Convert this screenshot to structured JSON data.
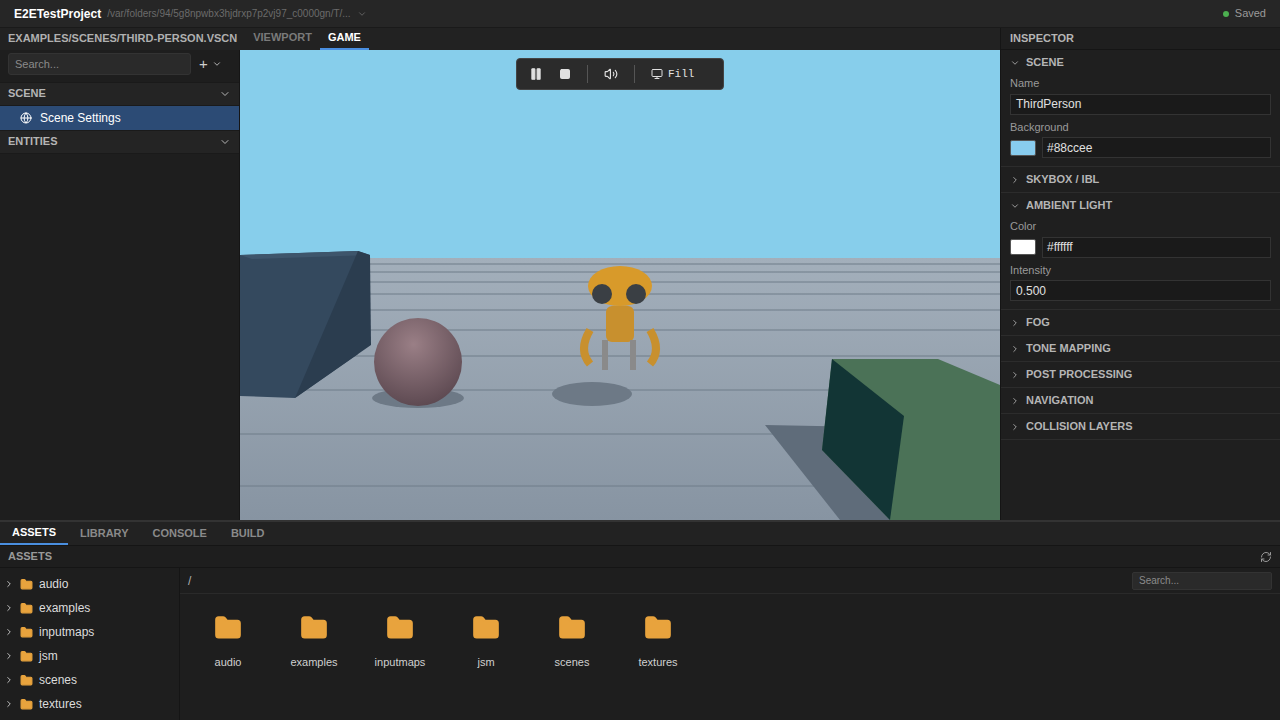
{
  "titlebar": {
    "project": "E2ETestProject",
    "path": "/var/folders/94/5g8npwbx3hjdrxp7p2vj97_c0000gn/T/...",
    "status": "Saved"
  },
  "document_path": "EXAMPLES/SCENES/THIRD-PERSON.VSCN",
  "view_tabs": [
    {
      "label": "VIEWPORT",
      "selected": false
    },
    {
      "label": "GAME",
      "selected": true
    }
  ],
  "hierarchy": {
    "search_placeholder": "Search...",
    "add_button": "+",
    "sections": [
      {
        "label": "SCENE",
        "expanded": true,
        "items": [
          {
            "label": "Scene Settings",
            "selected": true
          }
        ]
      },
      {
        "label": "ENTITIES",
        "expanded": true,
        "items": []
      }
    ]
  },
  "game_toolbar": {
    "fill_label": "Fill"
  },
  "inspector": {
    "title": "INSPECTOR",
    "sections": [
      {
        "label": "SCENE",
        "expanded": true,
        "fields": [
          {
            "label": "Name",
            "kind": "text",
            "value": "ThirdPerson"
          },
          {
            "label": "Background",
            "kind": "color",
            "value": "#88ccee"
          }
        ]
      },
      {
        "label": "SKYBOX / IBL",
        "expanded": false,
        "fields": []
      },
      {
        "label": "AMBIENT LIGHT",
        "expanded": true,
        "fields": [
          {
            "label": "Color",
            "kind": "color",
            "value": "#ffffff"
          },
          {
            "label": "Intensity",
            "kind": "text",
            "value": "0.500"
          }
        ]
      },
      {
        "label": "FOG",
        "expanded": false,
        "fields": []
      },
      {
        "label": "TONE MAPPING",
        "expanded": false,
        "fields": []
      },
      {
        "label": "POST PROCESSING",
        "expanded": false,
        "fields": []
      },
      {
        "label": "NAVIGATION",
        "expanded": false,
        "fields": []
      },
      {
        "label": "COLLISION LAYERS",
        "expanded": false,
        "fields": []
      }
    ]
  },
  "bottom_tabs": [
    {
      "label": "ASSETS",
      "selected": true
    },
    {
      "label": "LIBRARY",
      "selected": false
    },
    {
      "label": "CONSOLE",
      "selected": false
    },
    {
      "label": "BUILD",
      "selected": false
    }
  ],
  "assets": {
    "title": "ASSETS",
    "tree": [
      {
        "label": "audio",
        "expanded": false
      },
      {
        "label": "examples",
        "expanded": false
      },
      {
        "label": "inputmaps",
        "expanded": false
      },
      {
        "label": "jsm",
        "expanded": false
      },
      {
        "label": "scenes",
        "expanded": false
      },
      {
        "label": "textures",
        "expanded": false
      }
    ],
    "path": "/",
    "search_placeholder": "Search...",
    "folders": [
      "audio",
      "examples",
      "inputmaps",
      "jsm",
      "scenes",
      "textures"
    ]
  }
}
